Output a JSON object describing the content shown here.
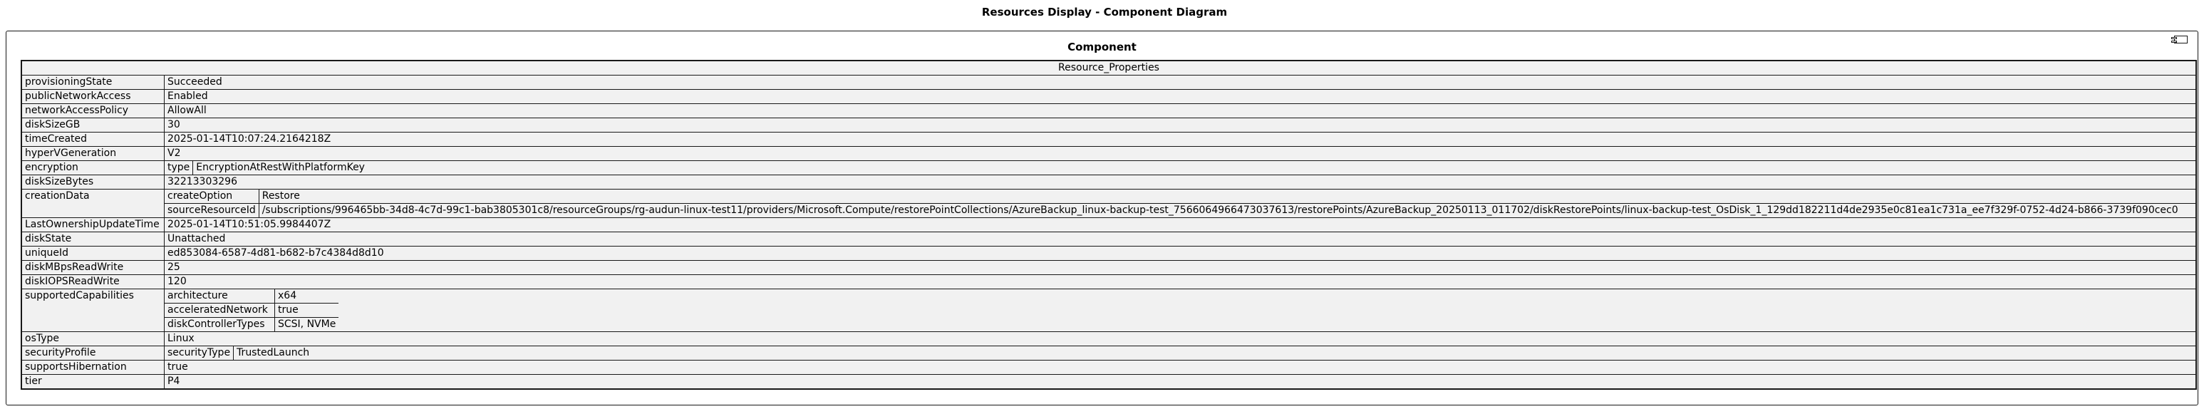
{
  "title": "Resources Display - Component Diagram",
  "component": {
    "name": "Component",
    "table_header": "Resource_Properties",
    "properties": {
      "provisioningState": "Succeeded",
      "publicNetworkAccess": "Enabled",
      "networkAccessPolicy": "AllowAll",
      "diskSizeGB": "30",
      "timeCreated": "2025-01-14T10:07:24.2164218Z",
      "hyperVGeneration": "V2",
      "encryption": {
        "type": "EncryptionAtRestWithPlatformKey"
      },
      "diskSizeBytes": "32213303296",
      "creationData": {
        "createOption": "Restore",
        "sourceResourceId": "/subscriptions/996465bb-34d8-4c7d-99c1-bab3805301c8/resourceGroups/rg-audun-linux-test11/providers/Microsoft.Compute/restorePointCollections/AzureBackup_linux-backup-test_7566064966473037613/restorePoints/AzureBackup_20250113_011702/diskRestorePoints/linux-backup-test_OsDisk_1_129dd182211d4de2935e0c81ea1c731a_ee7f329f-0752-4d24-b866-3739f090cec0"
      },
      "LastOwnershipUpdateTime": "2025-01-14T10:51:05.9984407Z",
      "diskState": "Unattached",
      "uniqueId": "ed853084-6587-4d81-b682-b7c4384d8d10",
      "diskMBpsReadWrite": "25",
      "diskIOPSReadWrite": "120",
      "supportedCapabilities": {
        "architecture": "x64",
        "acceleratedNetwork": "true",
        "diskControllerTypes": "SCSI, NVMe"
      },
      "osType": "Linux",
      "securityProfile": {
        "securityType": "TrustedLaunch"
      },
      "supportsHibernation": "true",
      "tier": "P4"
    }
  }
}
